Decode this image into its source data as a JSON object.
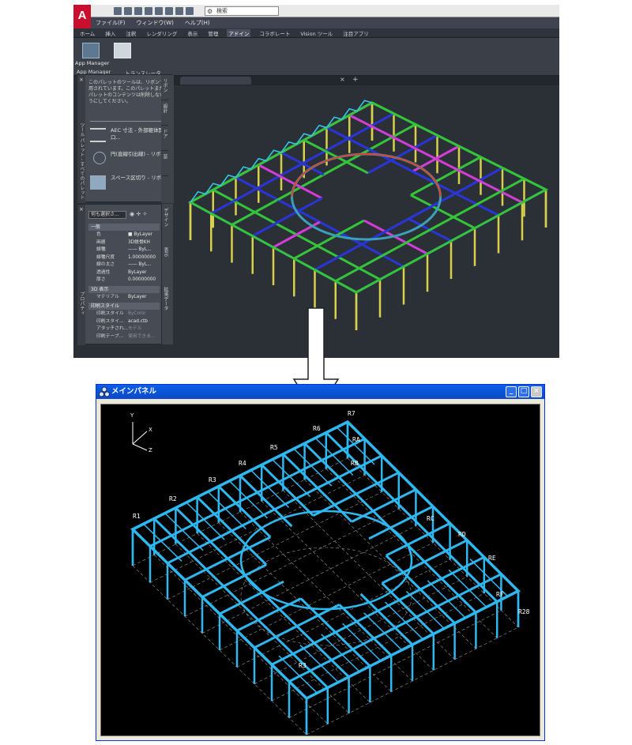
{
  "cad": {
    "app_logo": "A",
    "search_placeholder": "検索",
    "menu": [
      "ファイル(F)",
      "ウィンドウ(W)",
      "ヘルプ(H)"
    ],
    "ribbon_tabs": [
      "ホーム",
      "挿入",
      "注釈",
      "レンダリング",
      "表示",
      "管理",
      "アドイン",
      "コラボレート",
      "Vision ツール",
      "注目アプリ"
    ],
    "active_tab_index": 6,
    "ribbon_buttons": [
      "App Manager",
      ""
    ],
    "panel_labels": [
      "App Manager",
      "トランスレータ"
    ],
    "palette": {
      "note": "このパレットのツールは、リボンで利用されています。このパレットまたはパレットのコンテンツは削除しないようにしてください。",
      "tools": [
        "AEC 寸法 - 外部躯体開口...",
        "円(直線引出線) - リボン",
        "スペース区切り - リボン"
      ],
      "tabs": [
        "リボン",
        "設計",
        "ドア",
        "窓"
      ],
      "vertical_label": "ツール パレット - すべてのパレット"
    },
    "props": {
      "selector": "何も選択さ...",
      "vertical_label": "プロパティ",
      "side_tabs": [
        "デザイン",
        "表示",
        "拡張データ"
      ],
      "sections": [
        {
          "title": "一般",
          "rows": [
            {
              "k": "色",
              "v": "■ ByLayer",
              "dim": false
            },
            {
              "k": "画層",
              "v": "3D鉄骨KH",
              "dim": false
            },
            {
              "k": "線種",
              "v": "—— ByL...",
              "dim": false
            },
            {
              "k": "線種尺度",
              "v": "1.00000000",
              "dim": false
            },
            {
              "k": "線の太さ",
              "v": "—— ByL...",
              "dim": false
            },
            {
              "k": "透過性",
              "v": "ByLayer",
              "dim": false
            },
            {
              "k": "厚さ",
              "v": "0.00000000",
              "dim": false
            }
          ]
        },
        {
          "title": "3D 表示",
          "rows": [
            {
              "k": "マテリアル",
              "v": "ByLayer",
              "dim": false
            }
          ]
        },
        {
          "title": "印刷スタイル",
          "rows": [
            {
              "k": "印刷スタイル",
              "v": "ByColor",
              "dim": true
            },
            {
              "k": "印刷スタイ...",
              "v": "acad.ctb",
              "dim": false
            },
            {
              "k": "アタッチされ...",
              "v": "モデル",
              "dim": true
            },
            {
              "k": "印刷テーブ...",
              "v": "使用できま...",
              "dim": true
            }
          ]
        }
      ]
    }
  },
  "window": {
    "title": "メインパネル",
    "buttons": [
      "_",
      "□",
      "×"
    ],
    "axes": {
      "y": "Y",
      "x": "X",
      "z": "Z"
    },
    "grid_labels": [
      "R7",
      "R6",
      "R5",
      "R4",
      "R3",
      "R2",
      "R1",
      "RA",
      "RB",
      "RC",
      "RD",
      "RE",
      "RF",
      "R28",
      "R3"
    ],
    "model_color": "#2fb7f0"
  }
}
